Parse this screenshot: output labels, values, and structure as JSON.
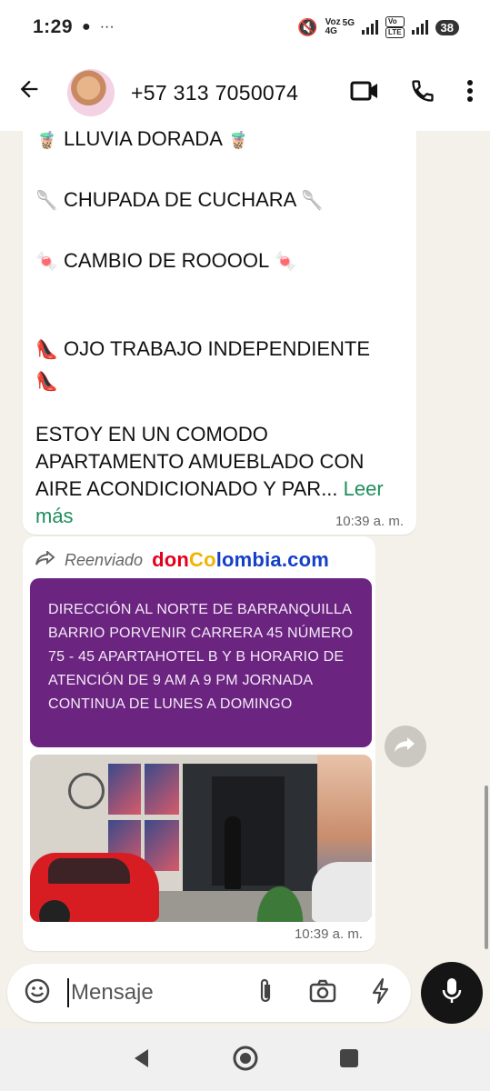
{
  "status_bar": {
    "time": "1:29",
    "voz_label": "Voz",
    "net_5g": "5G",
    "net_4g": "4G",
    "volte_label": "Vo",
    "lte_label": "LTE",
    "battery": "38"
  },
  "header": {
    "contact": "+57 313 7050074"
  },
  "messages": {
    "first": {
      "lines": [
        "LLUVIA DORADA",
        "CHUPADA DE CUCHARA",
        "CAMBIO DE ROOOOL",
        "OJO TRABAJO INDEPENDIENTE",
        " ESTOY EN UN COMODO",
        "APARTAMENTO AMUEBLADO CON",
        "AIRE ACONDICIONADO Y PAR..."
      ],
      "read_more_1": "Leer",
      "read_more_2": "más",
      "time": "10:39 a. m."
    },
    "second": {
      "forwarded_label": "Reenviado",
      "watermark_1": "don",
      "watermark_2": "Co",
      "watermark_3": "lombia.com",
      "image_text": "DIRECCIÓN AL NORTE DE BARRANQUILLA BARRIO PORVENIR CARRERA 45 NÚMERO 75 - 45 APARTAHOTEL B Y B HORARIO DE ATENCIÓN DE 9 AM A 9 PM JORNADA CONTINUA DE LUNES A DOMINGO",
      "time": "10:39 a. m."
    }
  },
  "input": {
    "placeholder": "Mensaje"
  },
  "icons": {
    "back": "arrow-left",
    "video": "video-camera",
    "call": "phone",
    "menu": "more-vertical",
    "emoji": "emoji",
    "attach": "paperclip",
    "camera": "camera",
    "bolt": "lightning",
    "mic": "microphone",
    "forward": "forward-arrow"
  },
  "colors": {
    "read_more": "#1f8e5c",
    "purple_card": "#6b2580",
    "chat_bg": "#f4f1ea"
  }
}
